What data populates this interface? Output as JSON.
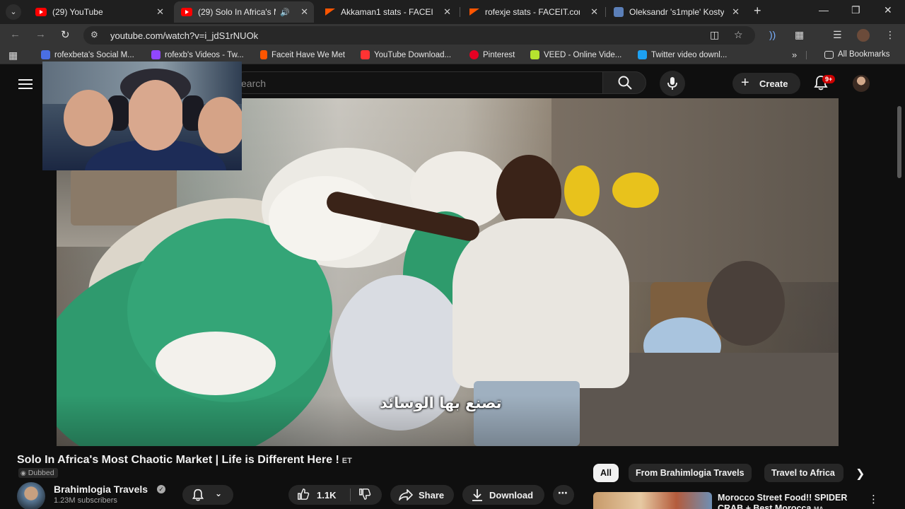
{
  "browser": {
    "tabs": [
      {
        "title": "(29) YouTube",
        "favicon": "youtube-icon",
        "active": false
      },
      {
        "title": "(29) Solo In Africa's M",
        "favicon": "youtube-icon",
        "active": true
      },
      {
        "title": "Akkaman1 stats - FACEIT",
        "favicon": "faceit-icon",
        "active": false
      },
      {
        "title": "rofexje stats - FACEIT.com",
        "favicon": "faceit-icon",
        "active": false
      },
      {
        "title": "Oleksandr 's1mple' Kosty",
        "favicon": "wiki-icon",
        "active": false
      }
    ],
    "url": "youtube.com/watch?v=i_jdS1rNUOk",
    "bookmarks": [
      {
        "label": "rofexbeta's Social M...",
        "color": "#4a6fe3"
      },
      {
        "label": "rofexb's Videos - Tw...",
        "color": "#9146ff"
      },
      {
        "label": "Faceit Have We Met",
        "color": "#ff5500"
      },
      {
        "label": "YouTube Download...",
        "color": "#ff3333"
      },
      {
        "label": "Pinterest",
        "color": "#e60023"
      },
      {
        "label": "VEED - Online Vide...",
        "color": "#b6e32f"
      },
      {
        "label": "Twitter video downl...",
        "color": "#1da1f2"
      }
    ],
    "all_bookmarks_label": "All Bookmarks"
  },
  "youtube": {
    "search_placeholder": "earch",
    "create_label": "Create",
    "notification_count": "9+"
  },
  "video": {
    "subtitle": "تصنع بها الوسائد",
    "title": "Solo In Africa's Most Chaotic Market | Life is Different Here !",
    "title_suffix": "ET",
    "dubbed_label": "Dubbed",
    "channel_name": "Brahimlogia Travels",
    "subscribers": "1.23M subscribers",
    "likes": "1.1K",
    "share_label": "Share",
    "download_label": "Download"
  },
  "sidebar": {
    "chips": [
      "All",
      "From Brahimlogia Travels",
      "Travel to Africa"
    ],
    "recommended": {
      "title": "Morocco Street Food!! SPIDER CRAB + Best Morocca",
      "badge": "MA"
    }
  },
  "colors": {
    "accent": "#ff0000",
    "chip_active": "#f1f1f1",
    "badge": "#cc0000"
  }
}
